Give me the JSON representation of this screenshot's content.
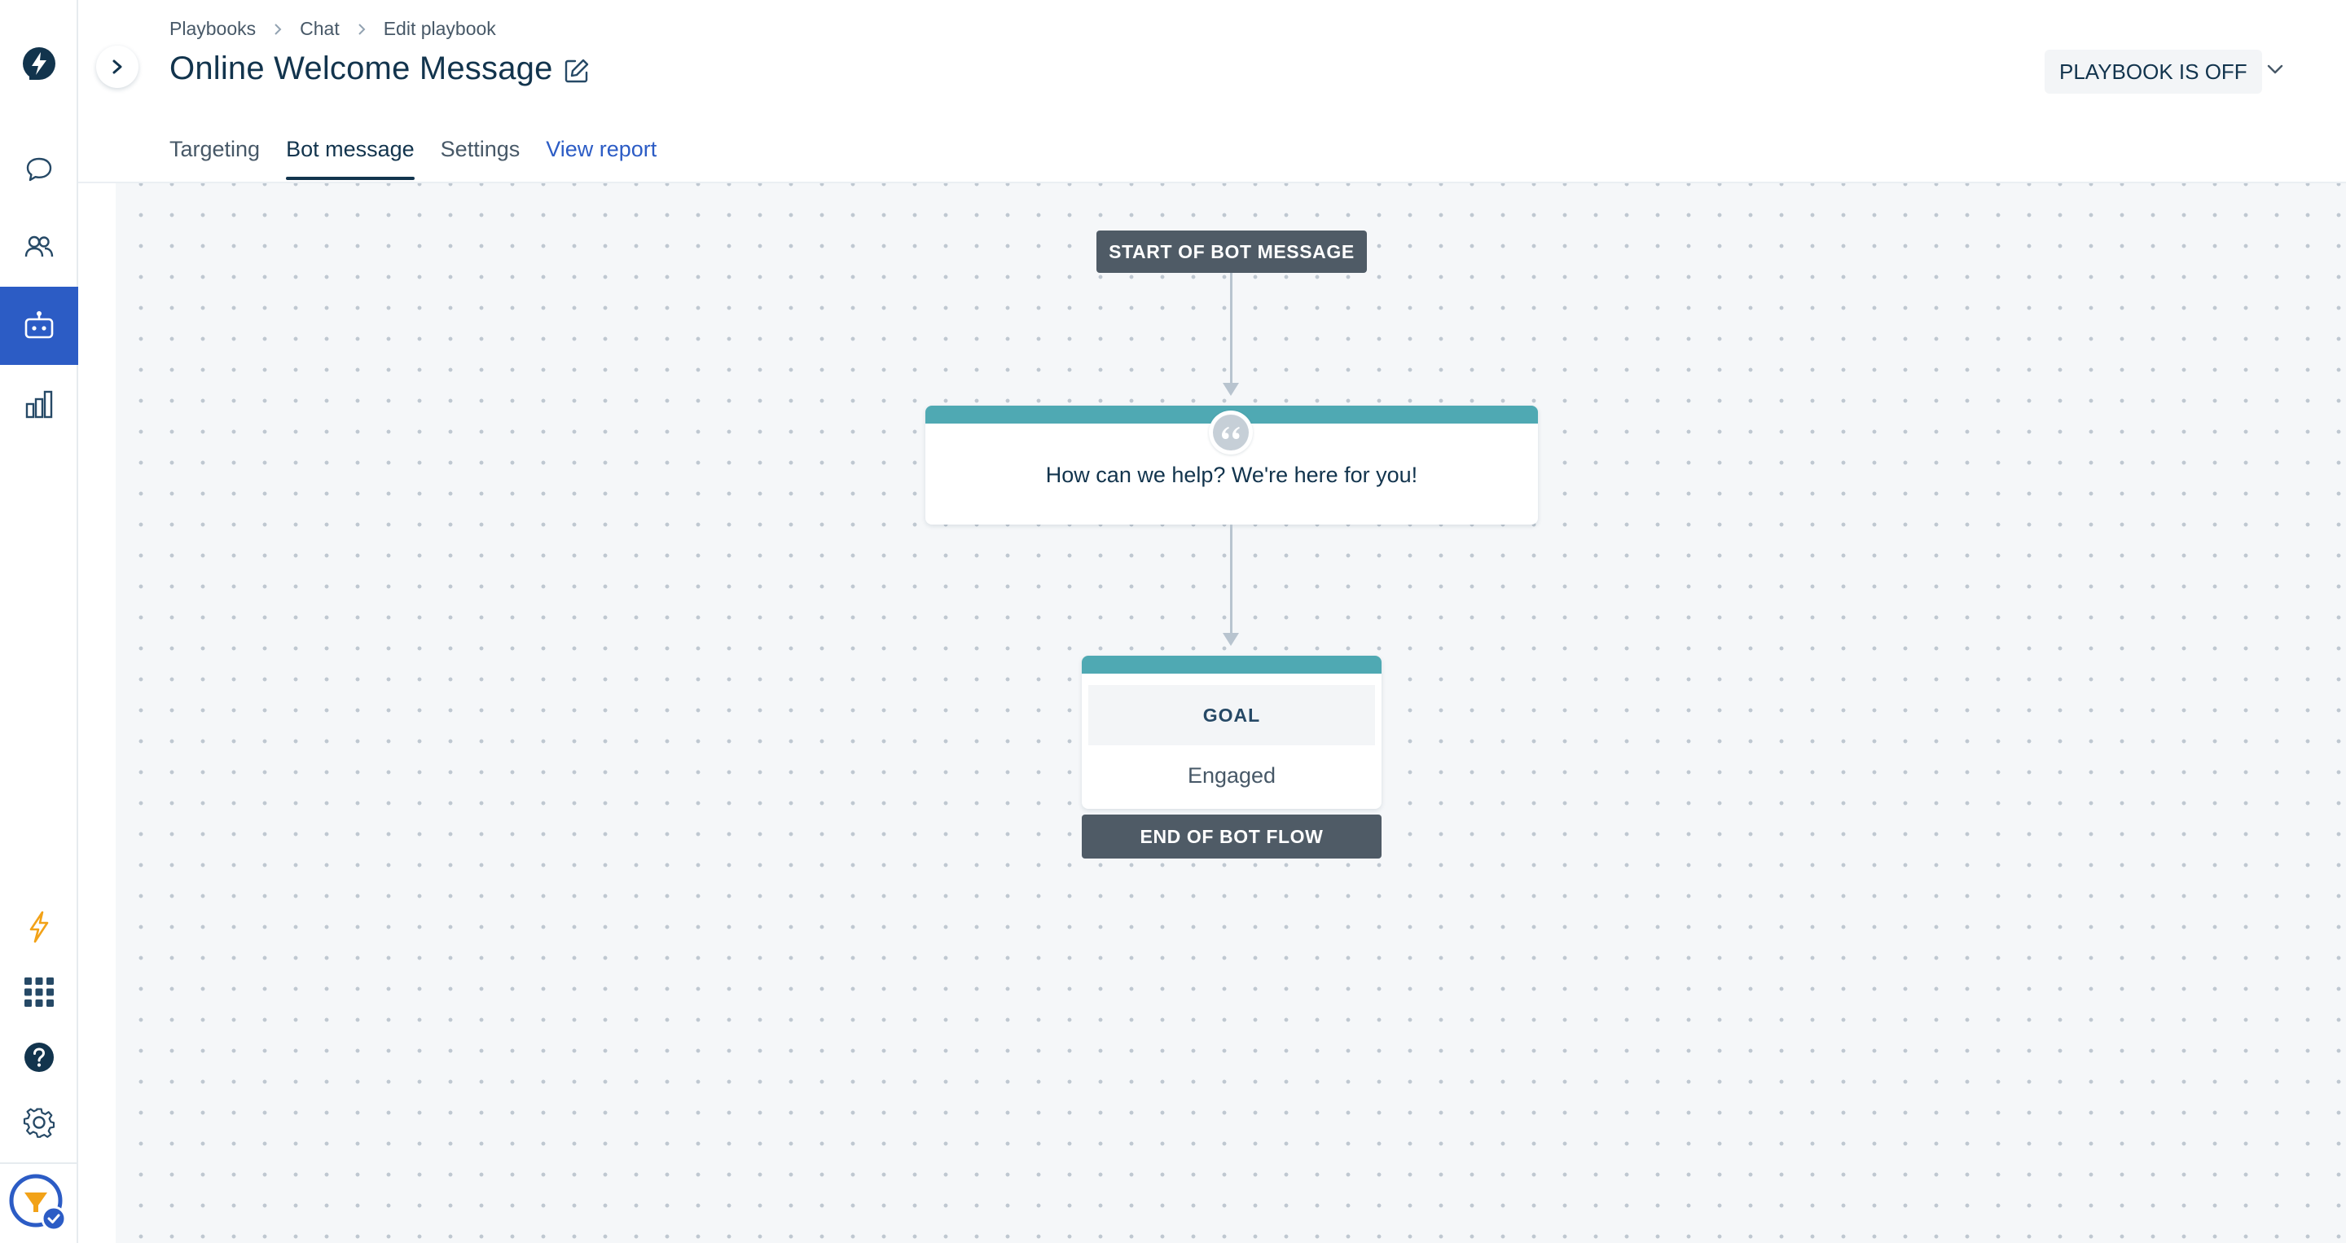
{
  "sidebar": {
    "items": [
      {
        "icon": "freshdesk-logo-icon"
      },
      {
        "icon": "chat-bubble-icon"
      },
      {
        "icon": "contacts-icon"
      },
      {
        "icon": "bot-icon",
        "active": true
      },
      {
        "icon": "bar-chart-icon"
      },
      {
        "icon": "lightning-icon"
      },
      {
        "icon": "apps-grid-icon"
      },
      {
        "icon": "help-icon"
      },
      {
        "icon": "settings-gear-icon"
      },
      {
        "icon": "user-avatar-icon"
      }
    ],
    "active_color": "#2c5cc5"
  },
  "header": {
    "breadcrumb": [
      "Playbooks",
      "Chat",
      "Edit playbook"
    ],
    "title": "Online Welcome Message",
    "status_label": "PLAYBOOK IS OFF"
  },
  "tabs": [
    {
      "label": "Targeting"
    },
    {
      "label": "Bot message",
      "active": true
    },
    {
      "label": "Settings"
    },
    {
      "label": "View report",
      "link": true
    }
  ],
  "flow": {
    "start_label": "START OF BOT MESSAGE",
    "message_text": "How can we help? We're here for you!",
    "goal_label": "GOAL",
    "goal_value": "Engaged",
    "end_label": "END OF BOT FLOW"
  },
  "colors": {
    "accent": "#2c5cc5",
    "card_top": "#4fa9b3",
    "dark_pill": "#4f5b66"
  }
}
